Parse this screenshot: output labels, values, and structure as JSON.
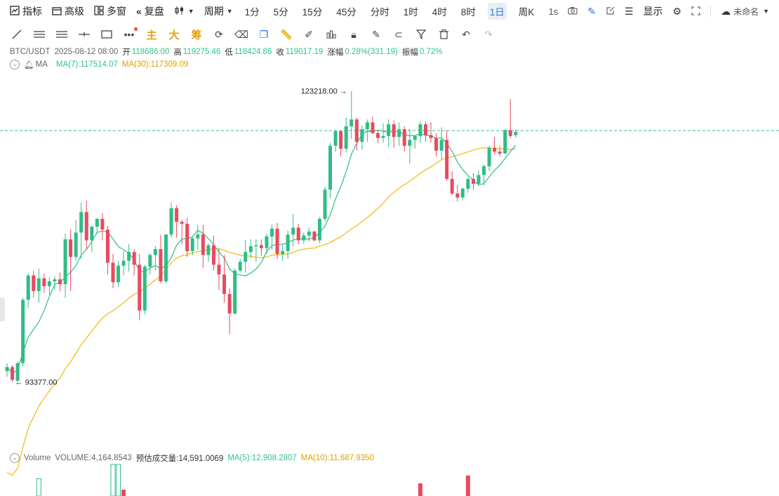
{
  "topbar": {
    "indicator": "指标",
    "advanced": "高级",
    "multi": "多窗",
    "replay": "复盘",
    "period": "周期",
    "periods": [
      "1分",
      "5分",
      "15分",
      "45分",
      "分时",
      "1时",
      "4时",
      "8时",
      "1日",
      "周K"
    ],
    "active_period": "1日",
    "interval": "1s",
    "display": "显示",
    "unnamed": "未命名"
  },
  "toolbar": {
    "text_tools": [
      "主",
      "大",
      "筹"
    ]
  },
  "info": {
    "symbol": "BTC/USDT",
    "date": "2025-08-12 08:00",
    "open_label": "开",
    "open": "118686.00",
    "high_label": "高",
    "high": "119275.46",
    "low_label": "低",
    "low": "118424.86",
    "close_label": "收",
    "close": "119017.19",
    "change_label": "涨幅",
    "change": "0.28%(331.19)",
    "amp_label": "振幅",
    "amp": "0.72%"
  },
  "ma": {
    "label": "MA",
    "ma7": "MA(7):117514.07",
    "ma30": "MA(30):117309.09"
  },
  "volume": {
    "label": "Volume",
    "volume": "VOLUME:4,164.8543",
    "est": "预估成交量:14,591.0069",
    "ma5": "MA(5):12,908.2807",
    "ma10": "MA(10):11,687.9350"
  },
  "chart_data": {
    "type": "candlestick",
    "colors": {
      "up": "#2ebd85",
      "down": "#e84a5f",
      "ma7": "#2ebd85",
      "ma30": "#f0b90b"
    },
    "price_max_label": "123218.00",
    "price_min_label": "93377.00",
    "current_price": 119017.19,
    "ylim": [
      86500,
      125500
    ],
    "candles": [
      [
        94500,
        95300,
        93900,
        94900
      ],
      [
        94900,
        95100,
        93377,
        93600
      ],
      [
        93500,
        95500,
        93400,
        95300
      ],
      [
        95300,
        102000,
        95000,
        101800
      ],
      [
        101800,
        104500,
        101000,
        104300
      ],
      [
        104300,
        104800,
        102000,
        102700
      ],
      [
        102700,
        105000,
        101500,
        104000
      ],
      [
        104000,
        104500,
        102500,
        103200
      ],
      [
        103200,
        104100,
        102300,
        103700
      ],
      [
        103700,
        104200,
        102800,
        103900
      ],
      [
        103900,
        104600,
        102700,
        103400
      ],
      [
        103400,
        108600,
        102000,
        108000
      ],
      [
        108000,
        109000,
        102700,
        106200
      ],
      [
        106200,
        110000,
        105800,
        108700
      ],
      [
        108700,
        111800,
        106000,
        110800
      ],
      [
        110800,
        112000,
        107000,
        107900
      ],
      [
        107900,
        109400,
        106700,
        109300
      ],
      [
        109300,
        110200,
        108600,
        110100
      ],
      [
        110100,
        110700,
        107900,
        109000
      ],
      [
        109000,
        109400,
        104400,
        105600
      ],
      [
        105600,
        106500,
        103000,
        103600
      ],
      [
        103600,
        105800,
        103100,
        105300
      ],
      [
        105300,
        106800,
        104300,
        105800
      ],
      [
        105800,
        107500,
        104700,
        106700
      ],
      [
        106700,
        107000,
        104300,
        105400
      ],
      [
        105400,
        106500,
        99700,
        100700
      ],
      [
        100700,
        105400,
        100300,
        105200
      ],
      [
        105200,
        106600,
        104400,
        106400
      ],
      [
        106400,
        107300,
        104800,
        107000
      ],
      [
        107000,
        108500,
        103500,
        103700
      ],
      [
        103700,
        108500,
        103500,
        108500
      ],
      [
        108500,
        111800,
        108200,
        111200
      ],
      [
        111200,
        111500,
        108200,
        109800
      ],
      [
        109800,
        110000,
        107500,
        109600
      ],
      [
        109600,
        110200,
        106200,
        106800
      ],
      [
        106800,
        108200,
        106400,
        108100
      ],
      [
        108100,
        109500,
        106900,
        108500
      ],
      [
        108500,
        109500,
        105100,
        106400
      ],
      [
        106400,
        107600,
        105700,
        107400
      ],
      [
        107400,
        108400,
        104800,
        105400
      ],
      [
        105400,
        107000,
        102800,
        104400
      ],
      [
        104400,
        106400,
        101500,
        102400
      ],
      [
        102400,
        103000,
        98300,
        100400
      ],
      [
        100400,
        105000,
        100300,
        104800
      ],
      [
        104800,
        106000,
        104600,
        105700
      ],
      [
        105700,
        107900,
        104600,
        106700
      ],
      [
        106700,
        108000,
        106100,
        107300
      ],
      [
        107300,
        108000,
        105700,
        107400
      ],
      [
        107400,
        108000,
        106300,
        107100
      ],
      [
        107100,
        108600,
        106500,
        108300
      ],
      [
        108300,
        109500,
        106900,
        109100
      ],
      [
        109100,
        109700,
        106000,
        106500
      ],
      [
        106500,
        107500,
        105800,
        106800
      ],
      [
        106800,
        108900,
        106000,
        108500
      ],
      [
        108500,
        110600,
        107300,
        109200
      ],
      [
        109200,
        109600,
        107500,
        107900
      ],
      [
        107900,
        108700,
        107500,
        108400
      ],
      [
        108400,
        109200,
        107800,
        108800
      ],
      [
        108800,
        108900,
        107800,
        107900
      ],
      [
        107900,
        110300,
        107600,
        110100
      ],
      [
        110100,
        113400,
        109800,
        113100
      ],
      [
        113100,
        117900,
        112200,
        117600
      ],
      [
        117600,
        119200,
        117000,
        119100
      ],
      [
        119100,
        118900,
        116500,
        117300
      ],
      [
        117300,
        120500,
        116900,
        119600
      ],
      [
        119600,
        123218,
        118300,
        120300
      ],
      [
        120300,
        120500,
        117100,
        118000
      ],
      [
        118000,
        119700,
        117200,
        119300
      ],
      [
        119300,
        120300,
        118000,
        120000
      ],
      [
        120000,
        120600,
        118800,
        118900
      ],
      [
        118900,
        119200,
        117900,
        118400
      ],
      [
        118400,
        119900,
        117900,
        118600
      ],
      [
        118600,
        120300,
        117500,
        119800
      ],
      [
        119800,
        120200,
        117400,
        118500
      ],
      [
        118500,
        120000,
        117600,
        119300
      ],
      [
        119300,
        119600,
        117000,
        117600
      ],
      [
        117600,
        119300,
        115800,
        118200
      ],
      [
        118200,
        118500,
        117300,
        118600
      ],
      [
        118600,
        120100,
        117900,
        119800
      ],
      [
        119800,
        120100,
        118000,
        118700
      ],
      [
        118700,
        120000,
        117900,
        118400
      ],
      [
        118400,
        118900,
        116500,
        117100
      ],
      [
        117100,
        119500,
        116200,
        118200
      ],
      [
        118200,
        119200,
        114000,
        114200
      ],
      [
        114200,
        115000,
        112500,
        112700
      ],
      [
        112700,
        113600,
        111900,
        112300
      ],
      [
        112300,
        113300,
        112000,
        113200
      ],
      [
        113200,
        114400,
        112800,
        114200
      ],
      [
        114200,
        114800,
        113100,
        113700
      ],
      [
        113700,
        115100,
        113600,
        114600
      ],
      [
        114600,
        115700,
        113500,
        115500
      ],
      [
        115500,
        117600,
        115000,
        117400
      ],
      [
        117400,
        118500,
        116700,
        117000
      ],
      [
        117000,
        117600,
        116500,
        116800
      ],
      [
        116800,
        119300,
        116800,
        119200
      ],
      [
        119200,
        122400,
        118400,
        118600
      ],
      [
        118686,
        119275,
        118424,
        119017
      ]
    ],
    "volume_bars": [
      {
        "index": 6,
        "value": 0.55,
        "dir": "up"
      },
      {
        "index": 20,
        "value": 1.0,
        "dir": "up"
      },
      {
        "index": 21,
        "value": 1.0,
        "dir": "up"
      },
      {
        "index": 22,
        "value": 0.2,
        "dir": "down"
      },
      {
        "index": 78,
        "value": 0.4,
        "dir": "down"
      },
      {
        "index": 87,
        "value": 0.65,
        "dir": "down"
      }
    ]
  }
}
